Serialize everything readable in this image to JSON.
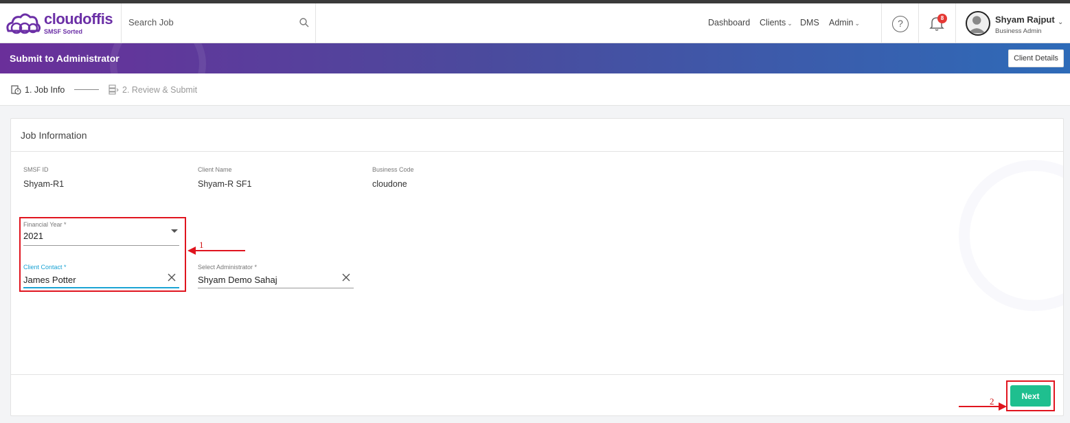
{
  "brand": {
    "name": "cloudoffis",
    "tagline": "SMSF Sorted",
    "color": "#6b2fa6"
  },
  "search": {
    "placeholder": "Search Job"
  },
  "nav": {
    "dashboard": "Dashboard",
    "clients": "Clients",
    "dms": "DMS",
    "admin": "Admin"
  },
  "notifications": {
    "count": "8"
  },
  "help_label": "?",
  "user": {
    "name": "Shyam Rajput",
    "role": "Business Admin"
  },
  "banner": {
    "title": "Submit to Administrator",
    "client_details_label": "Client Details"
  },
  "steps": [
    {
      "label": "1. Job Info",
      "active": true
    },
    {
      "label": "2. Review & Submit",
      "active": false
    }
  ],
  "job_info": {
    "title": "Job Information",
    "smsf_id_label": "SMSF ID",
    "smsf_id": "Shyam-R1",
    "client_name_label": "Client Name",
    "client_name": "Shyam-R SF1",
    "business_code_label": "Business Code",
    "business_code": "cloudone",
    "financial_year_label": "Financial Year *",
    "financial_year": "2021",
    "client_contact_label": "Client Contact *",
    "client_contact": "James Potter",
    "administrator_label": "Select Administrator *",
    "administrator": "Shyam Demo Sahaj"
  },
  "annotations": {
    "marker_1": "1",
    "marker_2": "2"
  },
  "next_label": "Next",
  "colors": {
    "accent": "#1fbf8f",
    "focus": "#1aa3d4",
    "annotation": "#e0141e"
  }
}
